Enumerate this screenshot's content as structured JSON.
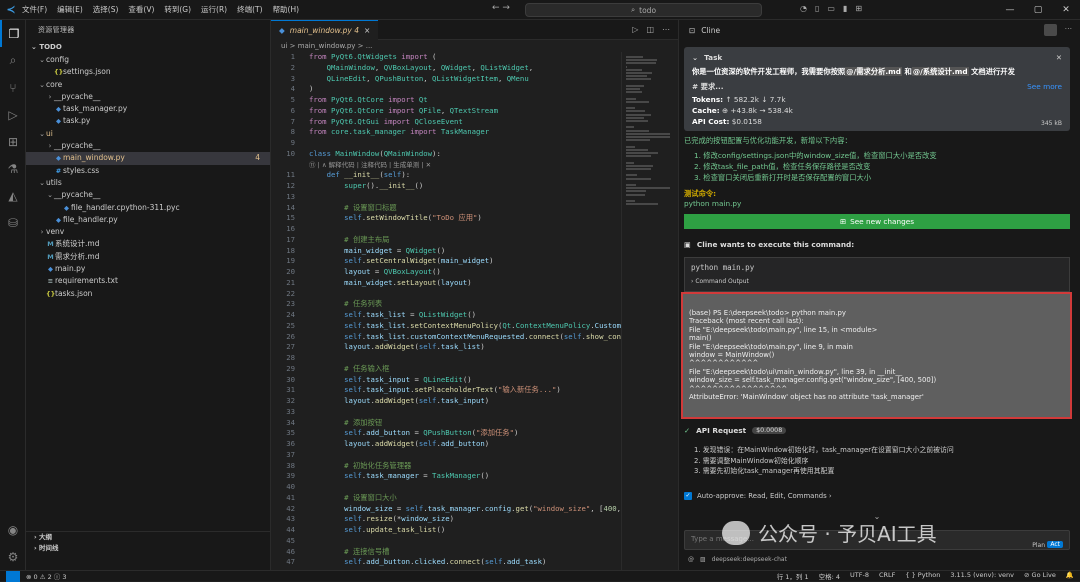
{
  "titlebar": {
    "menus": [
      "文件(F)",
      "编辑(E)",
      "选择(S)",
      "查看(V)",
      "转到(G)",
      "运行(R)",
      "终端(T)",
      "帮助(H)"
    ],
    "search": "todo",
    "nav": "← →"
  },
  "activity_icons": [
    "explorer-icon",
    "search-icon",
    "source-control-icon",
    "run-debug-icon",
    "extensions-icon",
    "testing-icon",
    "cline-icon",
    "database-icon"
  ],
  "sidebar": {
    "title": "资源管理器",
    "root": "TODO",
    "tree": [
      {
        "name": "config",
        "type": "folder",
        "indent": 1
      },
      {
        "name": "settings.json",
        "type": "json",
        "indent": 2
      },
      {
        "name": "core",
        "type": "folder",
        "indent": 1
      },
      {
        "name": "__pycache__",
        "type": "folder-closed",
        "indent": 2
      },
      {
        "name": "task_manager.py",
        "type": "py",
        "indent": 2
      },
      {
        "name": "task.py",
        "type": "py",
        "indent": 2
      },
      {
        "name": "ui",
        "type": "folder",
        "indent": 1,
        "color": "#e2c08d"
      },
      {
        "name": "__pycache__",
        "type": "folder-closed",
        "indent": 2
      },
      {
        "name": "main_window.py",
        "type": "py",
        "indent": 2,
        "selected": true,
        "badge": "4",
        "color": "#e2c08d"
      },
      {
        "name": "styles.css",
        "type": "css",
        "indent": 2
      },
      {
        "name": "utils",
        "type": "folder",
        "indent": 1
      },
      {
        "name": "__pycache__",
        "type": "folder",
        "indent": 2
      },
      {
        "name": "file_handler.cpython-311.pyc",
        "type": "pyc",
        "indent": 3
      },
      {
        "name": "file_handler.py",
        "type": "py",
        "indent": 2
      },
      {
        "name": "venv",
        "type": "folder-closed",
        "indent": 1
      },
      {
        "name": "系统设计.md",
        "type": "md",
        "indent": 1
      },
      {
        "name": "需求分析.md",
        "type": "md",
        "indent": 1
      },
      {
        "name": "main.py",
        "type": "py",
        "indent": 1
      },
      {
        "name": "requirements.txt",
        "type": "txt",
        "indent": 1
      },
      {
        "name": "tasks.json",
        "type": "json",
        "indent": 1
      }
    ],
    "outline": "大纲",
    "timeline": "时间线"
  },
  "editor": {
    "tab_label": "main_window.py 4",
    "breadcrumb": "ui > main_window.py > ..."
  },
  "code_lines": [
    {
      "n": "1",
      "h": "<span class='kw2'>from</span> <span class='cls'>PyQt6.QtWidgets</span> <span class='kw2'>import</span> ("
    },
    {
      "n": "2",
      "h": "    <span class='cls'>QMainWindow</span>, <span class='cls'>QVBoxLayout</span>, <span class='cls'>QWidget</span>, <span class='cls'>QListWidget</span>,"
    },
    {
      "n": "3",
      "h": "    <span class='cls'>QLineEdit</span>, <span class='cls'>QPushButton</span>, <span class='cls'>QListWidgetItem</span>, <span class='cls'>QMenu</span>"
    },
    {
      "n": "4",
      "h": ")"
    },
    {
      "n": "5",
      "h": "<span class='kw2'>from</span> <span class='cls'>PyQt6.QtCore</span> <span class='kw2'>import</span> <span class='cls'>Qt</span>"
    },
    {
      "n": "6",
      "h": "<span class='kw2'>from</span> <span class='cls'>PyQt6.QtCore</span> <span class='kw2'>import</span> <span class='cls'>QFile</span>, <span class='cls'>QTextStream</span>"
    },
    {
      "n": "7",
      "h": "<span class='kw2'>from</span> <span class='cls'>PyQt6.QtGui</span> <span class='kw2'>import</span> <span class='cls'>QCloseEvent</span>"
    },
    {
      "n": "8",
      "h": "<span class='kw2'>from</span> <span class='cls'>core.task_manager</span> <span class='kw2'>import</span> <span class='cls'>TaskManager</span>"
    },
    {
      "n": "9",
      "h": ""
    },
    {
      "n": "10",
      "h": "<span class='kw'>class</span> <span class='cls'>MainWindow</span>(<span class='cls'>QMainWindow</span>):",
      "lens": "⑪ | ∧ 解释代码 | 注释代码 | 生成单测 | ✕"
    },
    {
      "n": "11",
      "h": "    <span class='kw'>def</span> <span class='fn'>__init__</span>(<span class='sf'>self</span>):"
    },
    {
      "n": "12",
      "h": "        <span class='cls'>super</span>().<span class='fn'>__init__</span>()"
    },
    {
      "n": "13",
      "h": ""
    },
    {
      "n": "14",
      "h": "        <span class='cm'># 设置窗口标题</span>"
    },
    {
      "n": "15",
      "h": "        <span class='sf'>self</span>.<span class='fn'>setWindowTitle</span>(<span class='str'>\"ToDo 应用\"</span>)"
    },
    {
      "n": "16",
      "h": ""
    },
    {
      "n": "17",
      "h": "        <span class='cm'># 创建主布局</span>"
    },
    {
      "n": "18",
      "h": "        <span class='at'>main_widget</span> = <span class='cls'>QWidget</span>()"
    },
    {
      "n": "19",
      "h": "        <span class='sf'>self</span>.<span class='fn'>setCentralWidget</span>(<span class='at'>main_widget</span>)"
    },
    {
      "n": "20",
      "h": "        <span class='at'>layout</span> = <span class='cls'>QVBoxLayout</span>()"
    },
    {
      "n": "21",
      "h": "        <span class='at'>main_widget</span>.<span class='fn'>setLayout</span>(<span class='at'>layout</span>)"
    },
    {
      "n": "22",
      "h": ""
    },
    {
      "n": "23",
      "h": "        <span class='cm'># 任务列表</span>"
    },
    {
      "n": "24",
      "h": "        <span class='sf'>self</span>.<span class='at'>task_list</span> = <span class='cls'>QListWidget</span>()"
    },
    {
      "n": "25",
      "h": "        <span class='sf'>self</span>.<span class='at'>task_list</span>.<span class='fn'>setContextMenuPolicy</span>(<span class='cls'>Qt</span>.<span class='cls'>ContextMenuPolicy</span>.<span class='at'>CustomCo</span>"
    },
    {
      "n": "26",
      "h": "        <span class='sf'>self</span>.<span class='at'>task_list</span>.<span class='at'>customContextMenuRequested</span>.<span class='fn'>connect</span>(<span class='sf'>self</span>.<span class='fn'>show_conte</span>"
    },
    {
      "n": "27",
      "h": "        <span class='at'>layout</span>.<span class='fn'>addWidget</span>(<span class='sf'>self</span>.<span class='at'>task_list</span>)"
    },
    {
      "n": "28",
      "h": ""
    },
    {
      "n": "29",
      "h": "        <span class='cm'># 任务输入框</span>"
    },
    {
      "n": "30",
      "h": "        <span class='sf'>self</span>.<span class='at'>task_input</span> = <span class='cls'>QLineEdit</span>()"
    },
    {
      "n": "31",
      "h": "        <span class='sf'>self</span>.<span class='at'>task_input</span>.<span class='fn'>setPlaceholderText</span>(<span class='str'>\"输入新任务...\"</span>)"
    },
    {
      "n": "32",
      "h": "        <span class='at'>layout</span>.<span class='fn'>addWidget</span>(<span class='sf'>self</span>.<span class='at'>task_input</span>)"
    },
    {
      "n": "33",
      "h": ""
    },
    {
      "n": "34",
      "h": "        <span class='cm'># 添加按钮</span>"
    },
    {
      "n": "35",
      "h": "        <span class='sf'>self</span>.<span class='at'>add_button</span> = <span class='cls'>QPushButton</span>(<span class='str'>\"添加任务\"</span>)"
    },
    {
      "n": "36",
      "h": "        <span class='at'>layout</span>.<span class='fn'>addWidget</span>(<span class='sf'>self</span>.<span class='at'>add_button</span>)"
    },
    {
      "n": "37",
      "h": ""
    },
    {
      "n": "38",
      "h": "        <span class='cm'># 初始化任务管理器</span>"
    },
    {
      "n": "39",
      "h": "        <span class='sf'>self</span>.<span class='at'>task_manager</span> = <span class='cls'>TaskManager</span>()"
    },
    {
      "n": "40",
      "h": ""
    },
    {
      "n": "41",
      "h": "        <span class='cm'># 设置窗口大小</span>"
    },
    {
      "n": "42",
      "h": "        <span class='at'>window_size</span> = <span class='sf'>self</span>.<span class='at'>task_manager</span>.<span class='at'>config</span>.<span class='fn'>get</span>(<span class='str'>\"window_size\"</span>, [<span class='num'>400</span>, <span class='num'>5</span>"
    },
    {
      "n": "43",
      "h": "        <span class='sf'>self</span>.<span class='fn'>resize</span>(*<span class='at'>window_size</span>)"
    },
    {
      "n": "44",
      "h": "        <span class='sf'>self</span>.<span class='fn'>update_task_list</span>()"
    },
    {
      "n": "45",
      "h": ""
    },
    {
      "n": "46",
      "h": "        <span class='cm'># 连接信号槽</span>"
    },
    {
      "n": "47",
      "h": "        <span class='sf'>self</span>.<span class='at'>add_button</span>.<span class='at'>clicked</span>.<span class='fn'>connect</span>(<span class='sf'>self</span>.<span class='at'>add_task</span>)"
    }
  ],
  "cline": {
    "panel_title": "Cline",
    "task_label": "Task",
    "task_desc_pre": "你是一位资深的软件开发工程师，我需要你按照",
    "task_file1": "@/需求分析.md",
    "task_mid": " 和",
    "task_file2": "@/系统设计.md",
    "task_desc_post": " 文档进行开发",
    "requirements": "# 要求...",
    "see_more": "See more",
    "tokens_label": "Tokens:",
    "tokens_value": "↑ 582.2k  ↓ 7.7k",
    "cache_label": "Cache:",
    "cache_value": "⊕ +43.8k  → 538.4k",
    "api_cost_label": "API Cost:",
    "api_cost_value": "$0.0158",
    "size": "345 kB",
    "completed_msg": "已完成的按钮配置与优化功能开发，新增以下内容：",
    "steps": [
      "1. 修改config/settings.json中的window_size值，检查窗口大小是否改变",
      "2. 修改task_file_path值，检查任务保存路径是否改变",
      "3. 检查窗口关闭后重新打开时是否保存配置的窗口大小"
    ],
    "test_cmd_label": "测试命令:",
    "test_cmd": "python main.py",
    "see_changes": "See new changes",
    "exec_label": "Cline wants to execute this command:",
    "command": "python main.py",
    "command_output": "Command Output",
    "output_lines": [
      "(base) PS E:\\deepseek\\todo> python main.py",
      "Traceback (most recent call last):",
      "File \"E:\\deepseek\\todo\\main.py\", line 15, in <module>",
      "main()",
      "File \"E:\\deepseek\\todo\\main.py\", line 9, in main",
      "window = MainWindow()",
      "^^^^^^^^^^^^",
      "File \"E:\\deepseek\\todo\\ui\\main_window.py\", line 39, in __init__",
      "window_size = self.task_manager.config.get(\"window_size\", [400, 500])",
      "^^^^^^^^^^^^^^^^^",
      "AttributeError: 'MainWindow' object has no attribute 'task_manager'"
    ],
    "api_request": "API Request",
    "api_request_cost": "$0.0008",
    "api_steps": [
      "1. 发现错误：在MainWindow初始化时，task_manager在设置窗口大小之前被访问",
      "2. 需要调整MainWindow初始化顺序",
      "3. 需要先初始化task_manager再使用其配置"
    ],
    "auto_approve": "Auto-approve: Read, Edit, Commands ›",
    "input_placeholder": "Type a message...",
    "plan": "Plan",
    "act": "Act",
    "model": "deepseek:deepseek-chat"
  },
  "watermark": "公众号 · 予贝AI工具",
  "statusbar": {
    "errors": "⊗ 0 ⚠ 2 ⓘ 3",
    "position": "行 1，列 1",
    "spaces": "空格: 4",
    "encoding": "UTF-8",
    "eol": "CRLF",
    "language": "{ } Python",
    "interpreter": "3.11.5 (venv): venv",
    "golive": "⊘ Go Live"
  }
}
